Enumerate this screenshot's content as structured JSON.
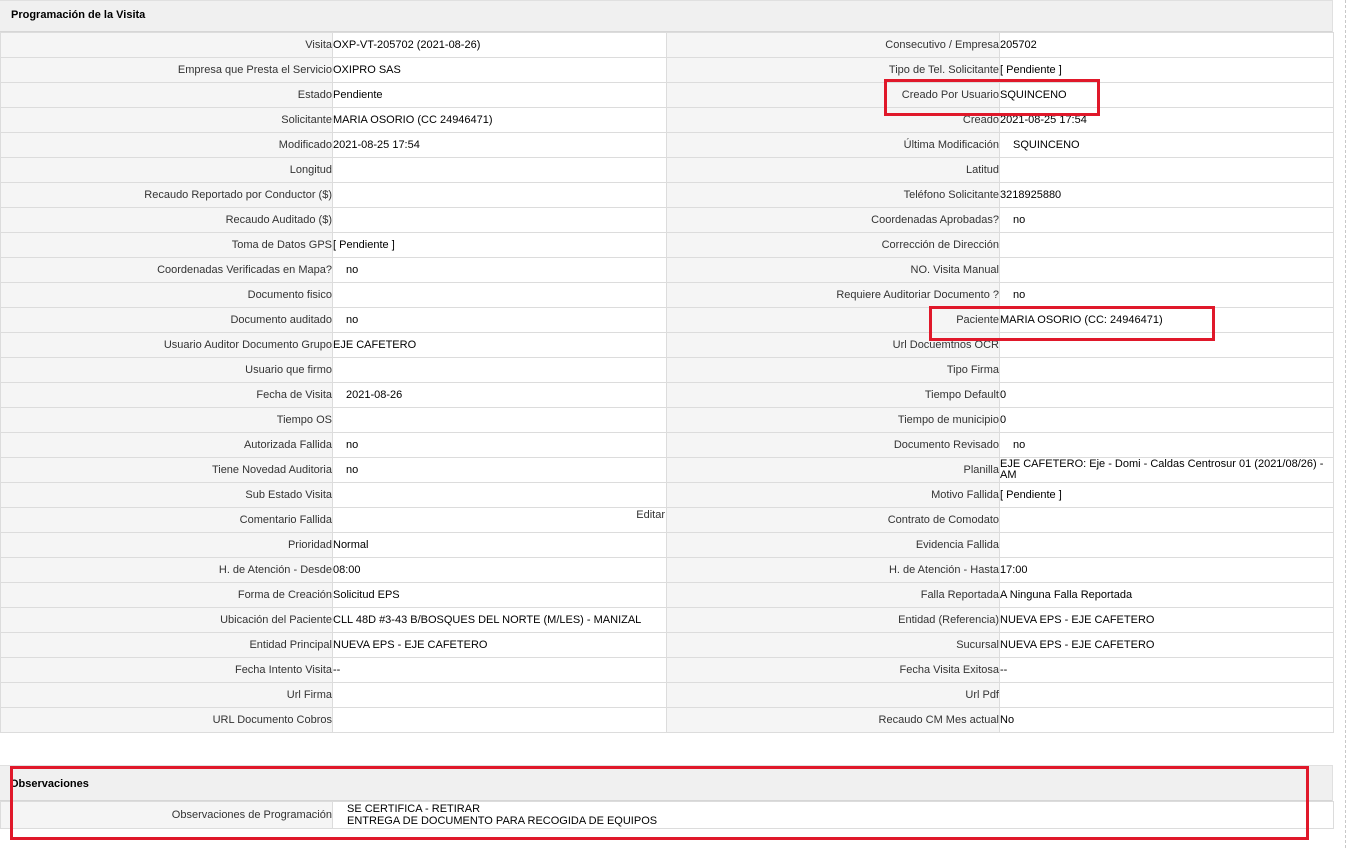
{
  "sections": {
    "schedule_title": "Programación de la Visita",
    "observations_title": "Observaciones"
  },
  "rows": [
    {
      "l1": "Visita",
      "v1": "OXP-VT-205702 (2021-08-26)",
      "l2": "Consecutivo / Empresa",
      "v2": "205702"
    },
    {
      "l1": "Empresa que Presta el Servicio",
      "v1": "OXIPRO SAS",
      "l2": "Tipo de Tel. Solicitante",
      "v2": "[ Pendiente ]"
    },
    {
      "l1": "Estado",
      "v1": "Pendiente",
      "l2": "Creado Por Usuario",
      "v2": "SQUINCENO"
    },
    {
      "l1": "Solicitante",
      "v1": "MARIA OSORIO (CC 24946471)",
      "l2": "Creado",
      "v2": "2021-08-25 17:54"
    },
    {
      "l1": "Modificado",
      "v1": "2021-08-25 17:54",
      "l2": "Última Modificación",
      "v2": "SQUINCENO"
    },
    {
      "l1": "Longitud",
      "v1": "",
      "l2": "Latitud",
      "v2": ""
    },
    {
      "l1": "Recaudo Reportado por Conductor ($)",
      "v1": "",
      "l2": "Teléfono Solicitante",
      "v2": "3218925880"
    },
    {
      "l1": "Recaudo Auditado ($)",
      "v1": "",
      "l2": "Coordenadas Aprobadas?",
      "v2": "no"
    },
    {
      "l1": "Toma de Datos GPS",
      "v1": "[ Pendiente ]",
      "l2": "Corrección de Dirección",
      "v2": ""
    },
    {
      "l1": "Coordenadas Verificadas en Mapa?",
      "v1": "no",
      "l2": "NO. Visita Manual",
      "v2": ""
    },
    {
      "l1": "Documento fisico",
      "v1": "",
      "l2": "Requiere Auditoriar Documento ?",
      "v2": "no"
    },
    {
      "l1": "Documento auditado",
      "v1": "no",
      "l2": "Paciente",
      "v2": "MARIA OSORIO (CC: 24946471)"
    },
    {
      "l1": "Usuario Auditor Documento Grupo",
      "v1": "EJE CAFETERO",
      "l2": "Url Docuemtnos OCR",
      "v2": ""
    },
    {
      "l1": "Usuario que firmo",
      "v1": "",
      "l2": "Tipo Firma",
      "v2": ""
    },
    {
      "l1": "Fecha de Visita",
      "v1": "2021-08-26",
      "l2": "Tiempo Default",
      "v2": "0"
    },
    {
      "l1": "Tiempo OS",
      "v1": "",
      "l2": "Tiempo de municipio",
      "v2": "0"
    },
    {
      "l1": "Autorizada Fallida",
      "v1": "no",
      "l2": "Documento Revisado",
      "v2": "no"
    },
    {
      "l1": "Tiene Novedad Auditoria",
      "v1": "no",
      "l2": "Planilla",
      "v2": "EJE CAFETERO: Eje - Domi - Caldas Centrosur 01 (2021/08/26) - AM"
    },
    {
      "l1": "Sub Estado Visita",
      "v1": "",
      "l2": "Motivo Fallida",
      "v2": "[ Pendiente ]"
    },
    {
      "l1": "Comentario Fallida",
      "v1": "",
      "l2": "Contrato de Comodato",
      "v2": ""
    },
    {
      "l1": "Prioridad",
      "v1": "Normal",
      "l2": "Evidencia Fallida",
      "v2": ""
    },
    {
      "l1": "H. de Atención - Desde",
      "v1": "08:00",
      "l2": "H. de Atención - Hasta",
      "v2": "17:00"
    },
    {
      "l1": "Forma de Creación",
      "v1": "Solicitud EPS",
      "l2": "Falla Reportada",
      "v2": "A Ninguna Falla Reportada"
    },
    {
      "l1": "Ubicación del Paciente",
      "v1": "CLL 48D #3-43 B/BOSQUES DEL NORTE (M/LES) - MANIZAL",
      "l2": "Entidad (Referencia)",
      "v2": "NUEVA EPS - EJE CAFETERO"
    },
    {
      "l1": "Entidad Principal",
      "v1": "NUEVA EPS - EJE CAFETERO",
      "l2": "Sucursal",
      "v2": "NUEVA EPS - EJE CAFETERO"
    },
    {
      "l1": "Fecha Intento Visita",
      "v1": "--",
      "l2": "Fecha Visita Exitosa",
      "v2": "--"
    },
    {
      "l1": "Url Firma",
      "v1": "",
      "l2": "Url Pdf",
      "v2": ""
    },
    {
      "l1": "URL Documento Cobros",
      "v1": "",
      "l2": "Recaudo CM Mes actual",
      "v2": "No"
    }
  ],
  "edit_link": "Editar",
  "observations": {
    "label": "Observaciones de Programación",
    "line1": "SE CERTIFICA - RETIRAR",
    "line2": "ENTREGA DE DOCUMENTO PARA RECOGIDA DE EQUIPOS"
  },
  "highlight_color": "#e0182a"
}
